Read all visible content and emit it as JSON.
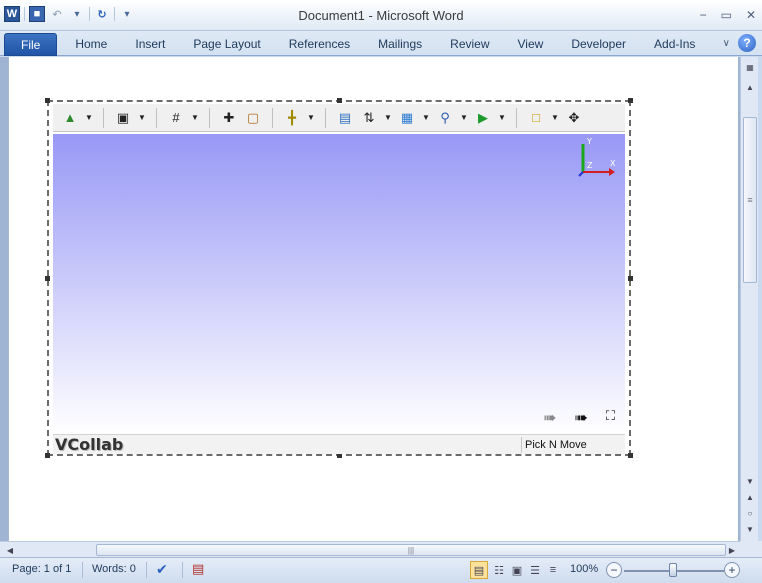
{
  "window": {
    "title": "Document1  -  Microsoft Word",
    "qat": {
      "app_icon": "W",
      "save_icon": "save-icon",
      "undo_icon": "undo-icon",
      "redo_icon": "redo-icon",
      "customize_icon": "customize-qat-icon"
    },
    "controls": {
      "minimize": "−",
      "maximize": "▭",
      "close": "✕"
    }
  },
  "ribbon": {
    "tabs": [
      {
        "label": "File"
      },
      {
        "label": "Home"
      },
      {
        "label": "Insert"
      },
      {
        "label": "Page Layout"
      },
      {
        "label": "References"
      },
      {
        "label": "Mailings"
      },
      {
        "label": "Review"
      },
      {
        "label": "View"
      },
      {
        "label": "Developer"
      },
      {
        "label": "Add-Ins"
      }
    ],
    "help": "?"
  },
  "viewer": {
    "logo": "VCollab",
    "mode": "Pick N Move",
    "axis": {
      "x": "X",
      "y": "Y",
      "z": "Z"
    },
    "colors": {
      "gradient_top": "#9898f6",
      "gradient_bottom": "#ffffff"
    }
  },
  "statusbar": {
    "page": "Page: 1 of 1",
    "words": "Words: 0",
    "zoom": "100%",
    "zoom_level_percent": 100
  }
}
